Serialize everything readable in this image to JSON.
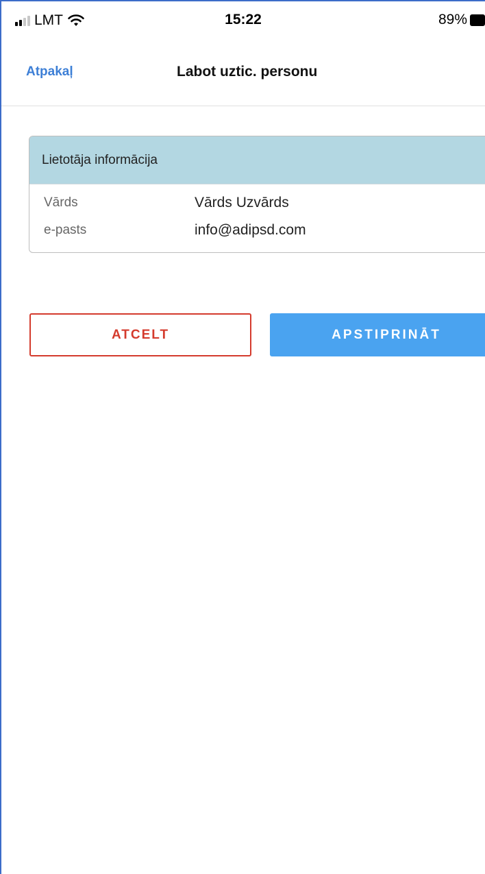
{
  "status_bar": {
    "carrier": "LMT",
    "time": "15:22",
    "battery_percent": "89%",
    "signal_icon": "signal-bars-icon",
    "wifi_icon": "wifi-icon",
    "battery_icon": "battery-icon"
  },
  "nav": {
    "back_label": "Atpakaļ",
    "title": "Labot uztic. personu"
  },
  "card": {
    "header": "Lietotāja informācija",
    "rows": [
      {
        "label": "Vārds",
        "value": "Vārds Uzvārds"
      },
      {
        "label": "e-pasts",
        "value": "info@adipsd.com"
      }
    ]
  },
  "actions": {
    "cancel_label": "ATCELT",
    "confirm_label": "APSTIPRINĀT"
  },
  "colors": {
    "accent_blue": "#4aa3f0",
    "link_blue": "#3d7fd6",
    "cancel_red": "#d43a2c",
    "card_header_bg": "#b3d7e2"
  }
}
